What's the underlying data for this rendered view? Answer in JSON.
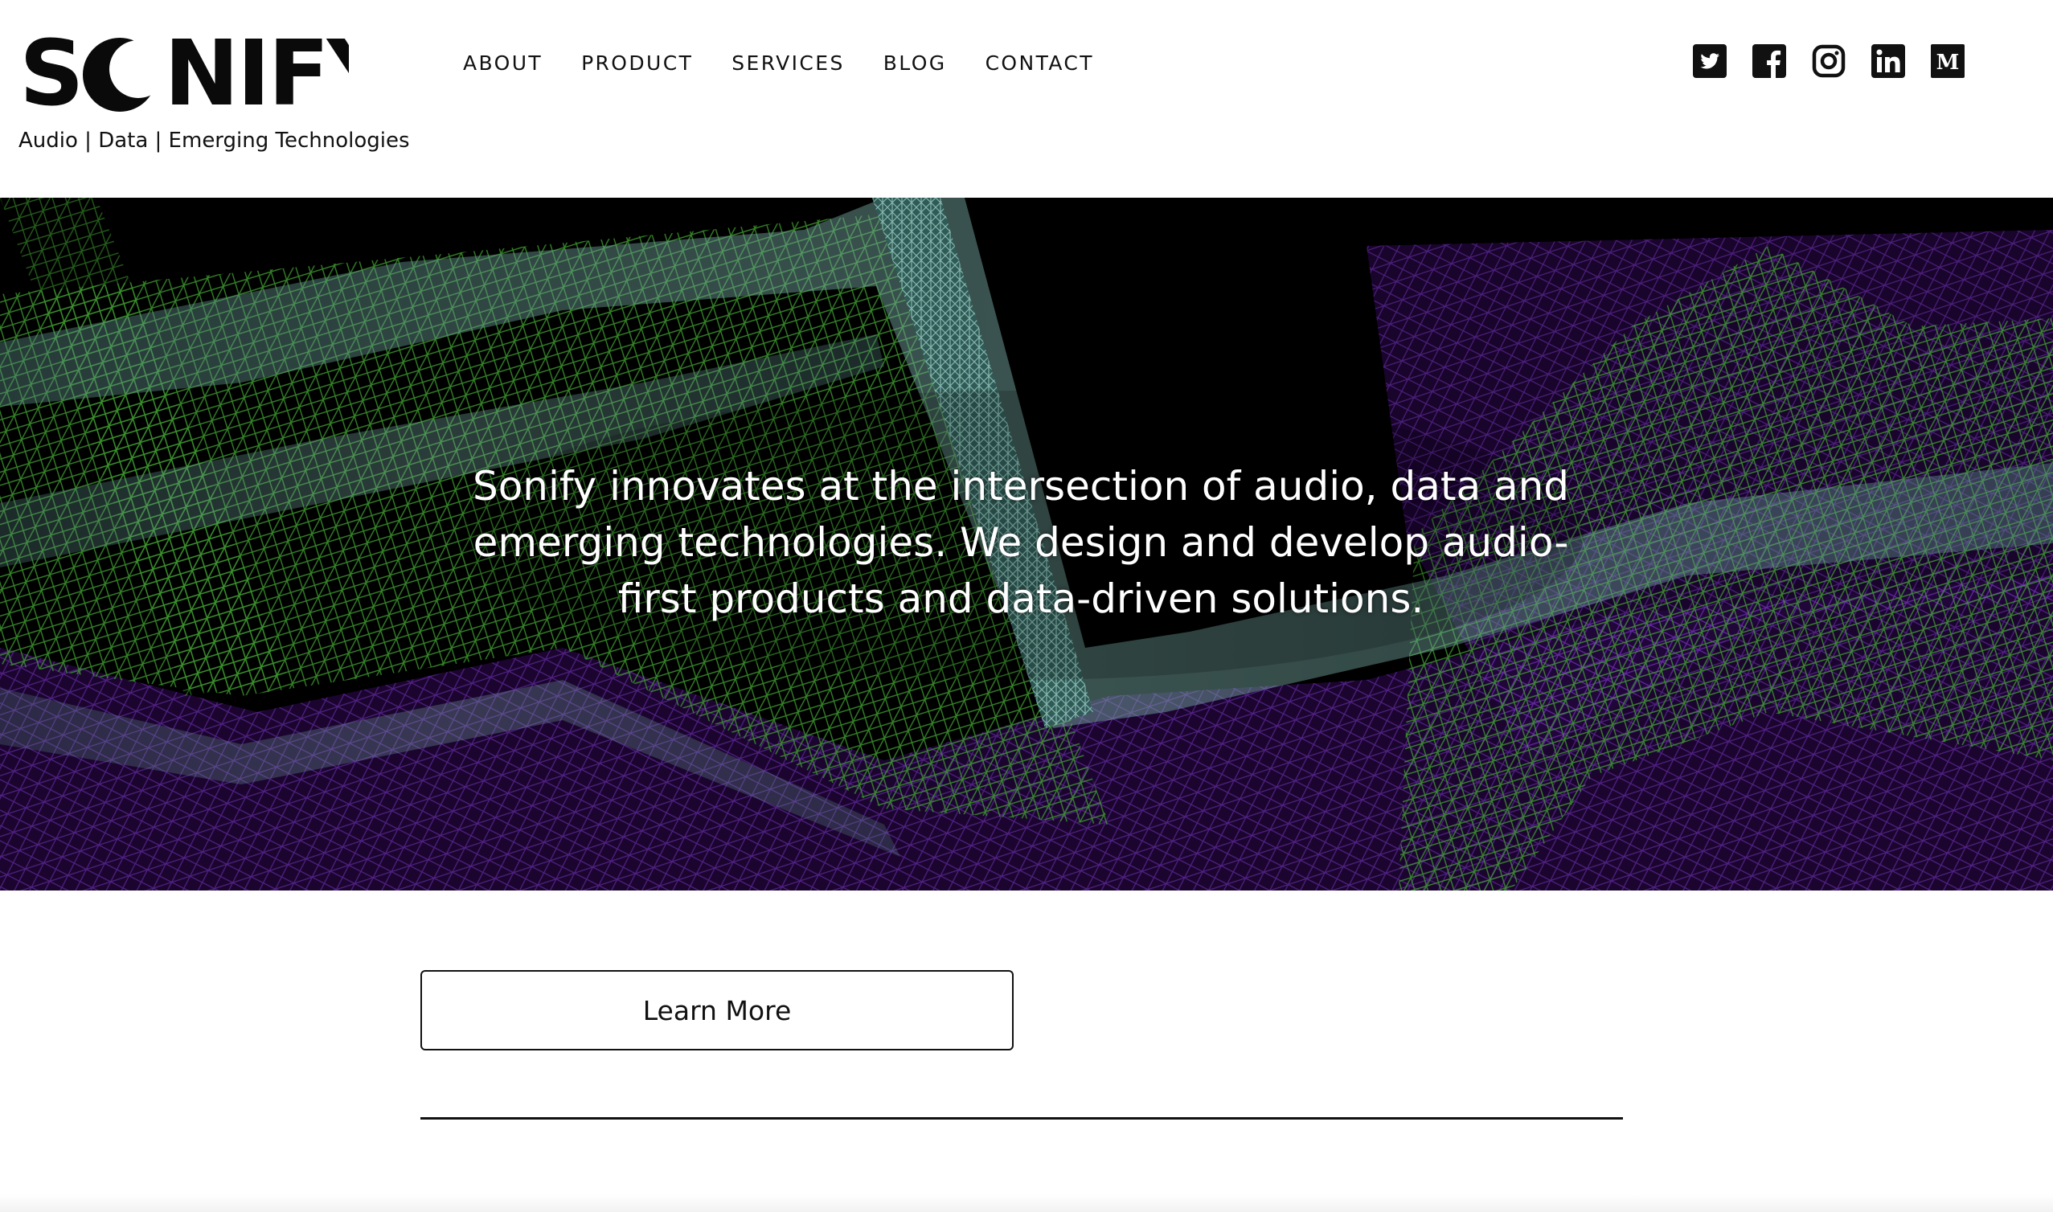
{
  "brand": {
    "logo_text": "SONIFY",
    "tagline": "Audio | Data | Emerging Technologies"
  },
  "nav": {
    "items": [
      {
        "label": "ABOUT"
      },
      {
        "label": "PRODUCT"
      },
      {
        "label": "SERVICES"
      },
      {
        "label": "BLOG"
      },
      {
        "label": "CONTACT"
      }
    ]
  },
  "social": {
    "icons": [
      "twitter-icon",
      "facebook-icon",
      "instagram-icon",
      "linkedin-icon",
      "medium-icon"
    ]
  },
  "hero": {
    "text": "Sonify innovates at the intersection of audio, data and emerging technologies. We design and develop audio-first products and data-driven solutions.",
    "colors": {
      "background": "#000000",
      "mesh_green": "#3c8a2e",
      "mesh_teal": "#6fa7a0",
      "mesh_purple": "#5a1a9a"
    }
  },
  "cta": {
    "label": "Learn More"
  }
}
